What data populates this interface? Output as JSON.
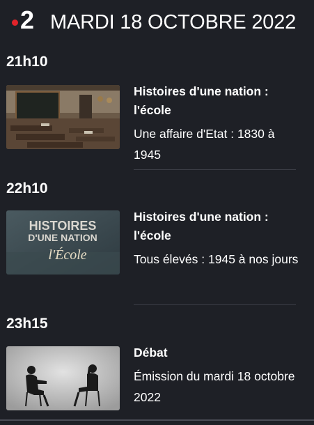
{
  "header": {
    "channel_logo": "2",
    "logo_dot_color": "#e2232a",
    "date": "MARDI 18 OCTOBRE 2022"
  },
  "programs": [
    {
      "time": "21h10",
      "title": "Histoires d'une nation : l'école",
      "subtitle": "Une affaire d'Etat : 1830 à 1945",
      "thumbnail": "classroom-photo"
    },
    {
      "time": "22h10",
      "title": "Histoires d'une nation : l'école",
      "subtitle": "Tous élevés : 1945 à nos jours",
      "thumbnail": "title-card",
      "thumbnail_text": {
        "line1": "HISTOIRES",
        "line2": "D'UNE NATION",
        "line3": "l'École"
      }
    },
    {
      "time": "23h15",
      "title": "Débat",
      "subtitle": "Émission du mardi 18 octobre 2022",
      "thumbnail": "debate-silhouettes"
    }
  ]
}
